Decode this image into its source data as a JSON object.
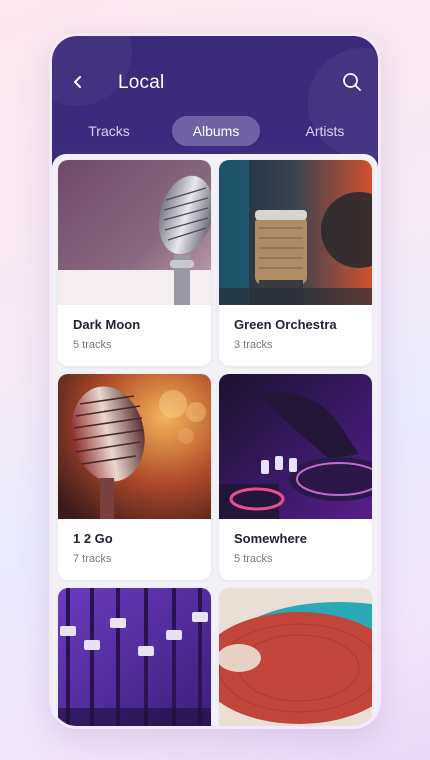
{
  "header": {
    "title": "Local"
  },
  "tabs": [
    {
      "label": "Tracks",
      "active": false
    },
    {
      "label": "Albums",
      "active": true
    },
    {
      "label": "Artists",
      "active": false
    }
  ],
  "albums": [
    {
      "name": "Dark Moon",
      "count": "5 tracks",
      "image": "vintage-microphone"
    },
    {
      "name": "Green Orchestra",
      "count": "3 tracks",
      "image": "studio-microphone"
    },
    {
      "name": "1 2 Go",
      "count": "7 tracks",
      "image": "red-microphone"
    },
    {
      "name": "Somewhere",
      "count": "5 tracks",
      "image": "dj-controller"
    },
    {
      "name": "",
      "count": "",
      "image": "mixing-console"
    },
    {
      "name": "",
      "count": "",
      "image": "vinyl-record"
    }
  ],
  "colors": {
    "header": "#3b2a7a",
    "active_tab": "#6f63a6",
    "background": "#f1f1f6"
  }
}
